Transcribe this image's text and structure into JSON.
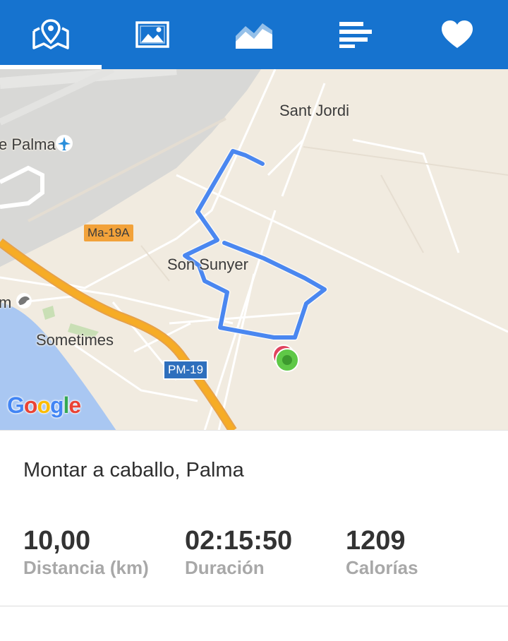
{
  "tabs": [
    {
      "icon": "map-icon",
      "active": true
    },
    {
      "icon": "image-icon",
      "active": false
    },
    {
      "icon": "chart-area-icon",
      "active": false
    },
    {
      "icon": "bars-icon",
      "active": false
    },
    {
      "icon": "heart-icon",
      "active": false
    }
  ],
  "map": {
    "labels": {
      "sant_jordi": "Sant Jordi",
      "palma": "e Palma",
      "son_sunyer": "Son Sunyer",
      "sometimes": "Sometimes",
      "m": "m"
    },
    "shields": {
      "ma19a": "Ma-19A",
      "pm19": "PM-19"
    },
    "google_logo": "Google",
    "route_color": "#4a87f0",
    "start_color": "#e0435d",
    "end_color": "#5fc847"
  },
  "activity": {
    "title": "Montar a caballo, Palma"
  },
  "stats": [
    {
      "value": "10,00",
      "label": "Distancia (km)"
    },
    {
      "value": "02:15:50",
      "label": "Duración"
    },
    {
      "value": "1209",
      "label": "Calorías"
    }
  ],
  "colors": {
    "header": "#1673cf",
    "accent_white": "#ffffff"
  }
}
